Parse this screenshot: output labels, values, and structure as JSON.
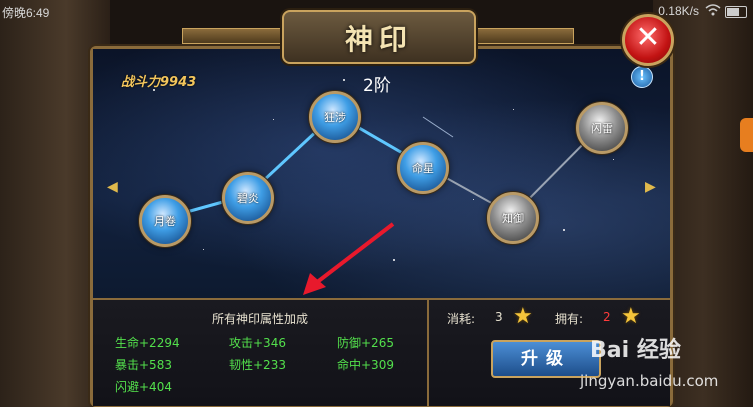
{
  "status_bar": {
    "time": "傍晚6:49",
    "net_speed": "0.18K/s"
  },
  "dialog": {
    "title": "神印",
    "close_label": "✕",
    "power_label": "战斗力9943",
    "tier_label": "2阶",
    "help_label": "!"
  },
  "nodes": [
    {
      "label": "月卷",
      "state": "active"
    },
    {
      "label": "碧炎",
      "state": "active"
    },
    {
      "label": "狂涉",
      "state": "active"
    },
    {
      "label": "命星",
      "state": "active"
    },
    {
      "label": "知御",
      "state": "locked"
    },
    {
      "label": "闪雷",
      "state": "locked"
    }
  ],
  "bonus": {
    "title": "所有神印属性加成",
    "stats": [
      "生命+2294",
      "攻击+346",
      "防御+265",
      "暴击+583",
      "韧性+233",
      "命中+309",
      "闪避+404"
    ]
  },
  "upgrade": {
    "cost_label": "消耗:",
    "cost_value": "3",
    "own_label": "拥有:",
    "own_value": "2",
    "button_label": "升级"
  },
  "watermark": {
    "brand": "Bai 经验",
    "url": "jingyan.baidu.com"
  },
  "colors": {
    "gold": "#c9a35e",
    "stat_green": "#53e04c",
    "own_red": "#ff3b3b",
    "active_node": "#3f9ee6",
    "locked_node": "#8c8c8c"
  }
}
